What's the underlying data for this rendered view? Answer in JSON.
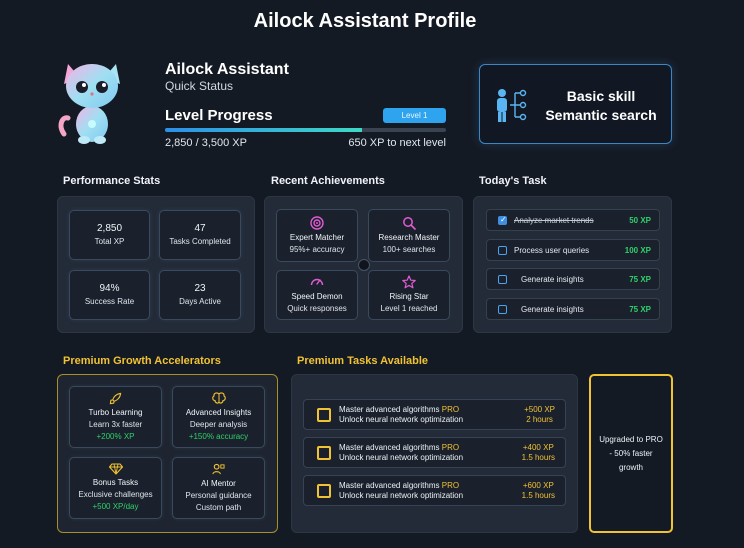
{
  "page_title": "Ailock Assistant Profile",
  "profile": {
    "name": "Ailock Assistant",
    "subtitle": "Quick Status",
    "level_progress_label": "Level Progress",
    "level_badge": "Level 1",
    "xp_current_text": "2,850 / 3,500 XP",
    "xp_to_next_text": "650 XP to next level",
    "progress_fraction": 0.7,
    "avatar_icon": "kitten-avatar"
  },
  "skill_card": {
    "line1": "Basic skill",
    "line2": "Semantic search",
    "icon": "person-network-icon"
  },
  "performance": {
    "title": "Performance Stats",
    "stats": [
      {
        "value": "2,850",
        "label": "Total XP"
      },
      {
        "value": "47",
        "label": "Tasks Completed"
      },
      {
        "value": "94%",
        "label": "Success Rate"
      },
      {
        "value": "23",
        "label": "Days Active"
      }
    ]
  },
  "achievements": {
    "title": "Recent Achievements",
    "items": [
      {
        "title": "Expert Matcher",
        "sub": "95%+ accuracy",
        "icon": "target-icon"
      },
      {
        "title": "Research Master",
        "sub": "100+ searches",
        "icon": "magnifier-icon"
      },
      {
        "title": "Speed Demon",
        "sub": "Quick responses",
        "icon": "speedometer-icon"
      },
      {
        "title": "Rising Star",
        "sub": "Level 1 reached",
        "icon": "star-icon"
      }
    ]
  },
  "todays_task": {
    "title": "Today's Task",
    "tasks": [
      {
        "name": "Analyze market trends",
        "xp": "50 XP",
        "done": true
      },
      {
        "name": "Process user queries",
        "xp": "100 XP",
        "done": false
      },
      {
        "name": "Generate insights",
        "xp": "75 XP",
        "done": false
      },
      {
        "name": "Generate insights",
        "xp": "75 XP",
        "done": false
      }
    ]
  },
  "accelerators": {
    "title": "Premium Growth Accelerators",
    "items": [
      {
        "title": "Turbo Learning",
        "sub": "Learn 3x faster",
        "extra": "+200% XP",
        "icon": "rocket-icon"
      },
      {
        "title": "Advanced Insights",
        "sub": "Deeper analysis",
        "extra": "+150% accuracy",
        "icon": "brain-icon"
      },
      {
        "title": "Bonus Tasks",
        "sub": "Exclusive challenges",
        "extra": "+500 XP/day",
        "icon": "diamond-icon"
      },
      {
        "title": "AI Mentor",
        "sub": "Personal guidance",
        "extra": "Custom path",
        "icon": "mentor-icon"
      }
    ]
  },
  "premium_tasks": {
    "title": "Premium Tasks Available",
    "items": [
      {
        "name": "Master advanced algorithms",
        "pro": "PRO",
        "desc": "Unlock neural network optimization",
        "xp": "+500 XP",
        "time": "2 hours"
      },
      {
        "name": "Master advanced algorithms",
        "pro": "PRO",
        "desc": "Unlock neural network optimization",
        "xp": "+400 XP",
        "time": "1.5 hours"
      },
      {
        "name": "Master advanced algorithms",
        "pro": "PRO",
        "desc": "Unlock neural network optimization",
        "xp": "+600 XP",
        "time": "1.5 hours"
      }
    ]
  },
  "upgrade": {
    "text": "Upgraded  to PRO - 50% faster growth"
  },
  "colors": {
    "background": "#141a24",
    "accent_blue": "#2ea3ee",
    "gold": "#f1c232",
    "green": "#2fd06a"
  }
}
